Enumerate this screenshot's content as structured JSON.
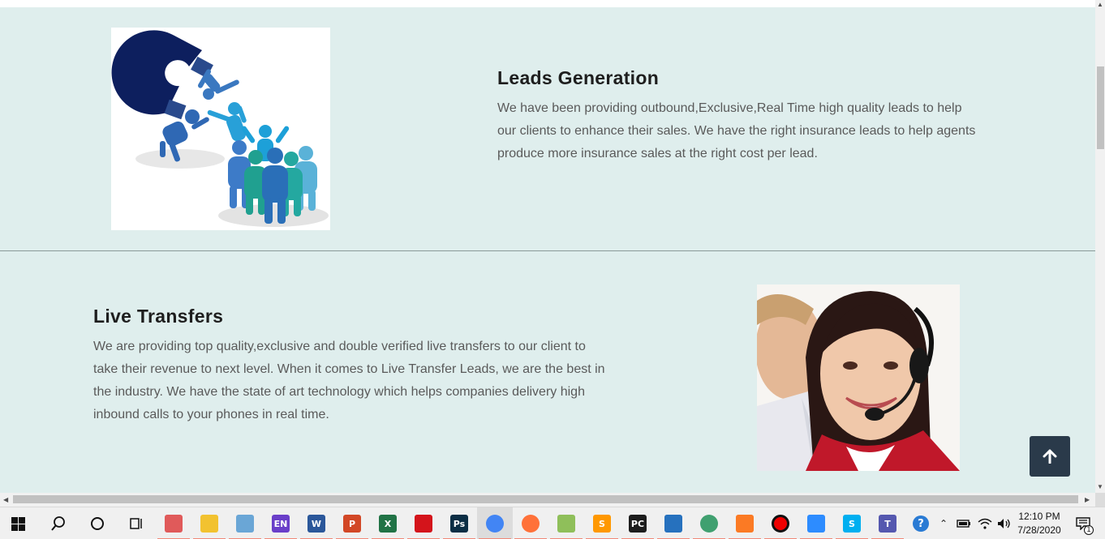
{
  "sections": {
    "leads": {
      "title": "Leads Generation",
      "text": "We have been providing outbound,Exclusive,Real Time high quality leads to help our clients to enhance their sales. We have the right insurance leads to help agents produce more insurance sales at the right cost per lead."
    },
    "live": {
      "title": "Live Transfers",
      "text": "We are providing top quality,exclusive and double verified live transfers to our client to take their revenue to next level. When it comes to Live Transfer Leads, we are the best in the industry. We have the state of art technology which helps companies delivery high inbound calls to your phones in real time."
    }
  },
  "back_to_top": {
    "icon": "arrow-up-icon"
  },
  "colors": {
    "section_bg": "#dfeeed",
    "button_bg": "#2a3a4a",
    "heading": "#1e1e1e",
    "body_text": "#5a5a5a"
  },
  "taskbar": {
    "apps": [
      {
        "name": "paint-3d",
        "label": "",
        "color": "#e05a5a"
      },
      {
        "name": "file-explorer",
        "label": "",
        "color": "#f2c230"
      },
      {
        "name": "notes",
        "label": "",
        "color": "#6aa6d6"
      },
      {
        "name": "en-app",
        "label": "EN",
        "color": "#6a3fc9"
      },
      {
        "name": "word",
        "label": "W",
        "color": "#2b579a"
      },
      {
        "name": "powerpoint",
        "label": "P",
        "color": "#d24726"
      },
      {
        "name": "excel",
        "label": "X",
        "color": "#217346"
      },
      {
        "name": "acrobat",
        "label": "",
        "color": "#d4141b"
      },
      {
        "name": "photoshop",
        "label": "Ps",
        "color": "#0c2e45"
      },
      {
        "name": "chrome",
        "label": "",
        "color": "#4285f4"
      },
      {
        "name": "firefox",
        "label": "",
        "color": "#ff7139"
      },
      {
        "name": "notepad-plus",
        "label": "",
        "color": "#8fbf5a"
      },
      {
        "name": "sublime-text",
        "label": "S",
        "color": "#ff9800"
      },
      {
        "name": "pycharm",
        "label": "PC",
        "color": "#1d1d1d"
      },
      {
        "name": "powershell",
        "label": "",
        "color": "#2671be"
      },
      {
        "name": "atom",
        "label": "",
        "color": "#40a070"
      },
      {
        "name": "xampp",
        "label": "",
        "color": "#fb7a24"
      },
      {
        "name": "recorder",
        "label": "",
        "color": "#111111"
      },
      {
        "name": "zoom",
        "label": "",
        "color": "#2d8cff"
      },
      {
        "name": "skype",
        "label": "S",
        "color": "#00aff0"
      },
      {
        "name": "teams",
        "label": "T",
        "color": "#5558af"
      }
    ],
    "clock": {
      "time": "12:10 PM",
      "date": "7/28/2020"
    },
    "notification_count": "1"
  }
}
